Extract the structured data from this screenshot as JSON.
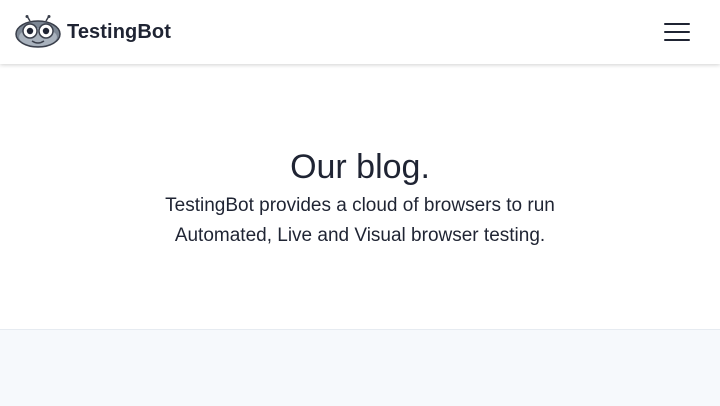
{
  "header": {
    "brand_name": "TestingBot",
    "logo_icon": "robot-logo-icon",
    "menu_icon": "hamburger-menu-icon"
  },
  "hero": {
    "title": "Our blog.",
    "subtitle": "TestingBot provides a cloud of browsers to run Automated, Live and Visual browser testing."
  },
  "colors": {
    "text": "#1f2433",
    "header_bg": "#ffffff",
    "section_bg": "#f6f9fc"
  }
}
